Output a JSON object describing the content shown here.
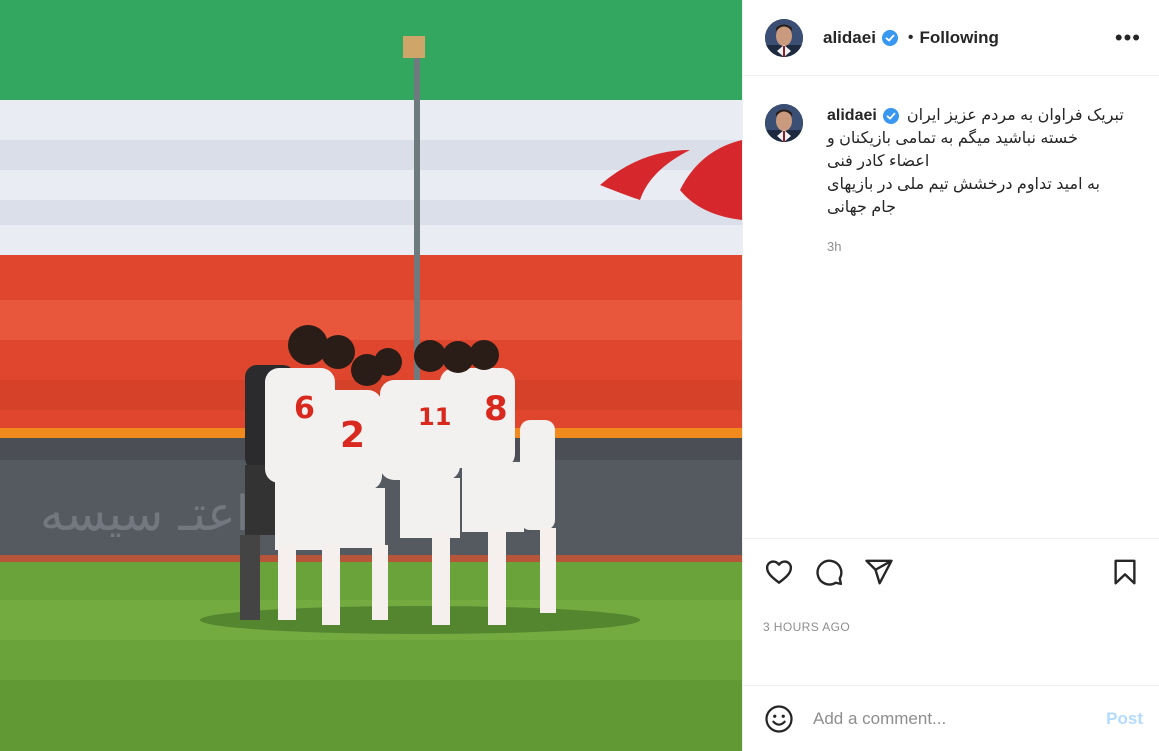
{
  "post": {
    "username": "alidaei",
    "follow_status": "Following",
    "more_label": "•••",
    "separator": "•",
    "caption_lines": [
      "تبریک فراوان به مردم عزیز ایران",
      "خسته نباشید میگم به تمامی بازیکنان و",
      "اعضاء کادر فنی",
      "به امید تداوم درخشش تیم ملی در بازیهای",
      "جام جهانی"
    ],
    "caption_time": "3h",
    "date": "3 HOURS AGO",
    "comment_placeholder": "Add a comment...",
    "post_label": "Post",
    "jersey_numbers": [
      "6",
      "2",
      "11",
      "8"
    ]
  },
  "colors": {
    "verified": "#3897f0",
    "post_disabled": "#b3dbff",
    "flag_green": "#2f9e5b",
    "flag_white": "#e9ecf2",
    "flag_red": "#e0462e",
    "grass": "#6aa33a"
  },
  "icons": {
    "like": "heart-icon",
    "comment": "comment-icon",
    "share": "paper-plane-icon",
    "save": "bookmark-icon",
    "emoji": "smiley-icon",
    "more": "more-options-icon",
    "verified": "verified-badge-icon"
  }
}
